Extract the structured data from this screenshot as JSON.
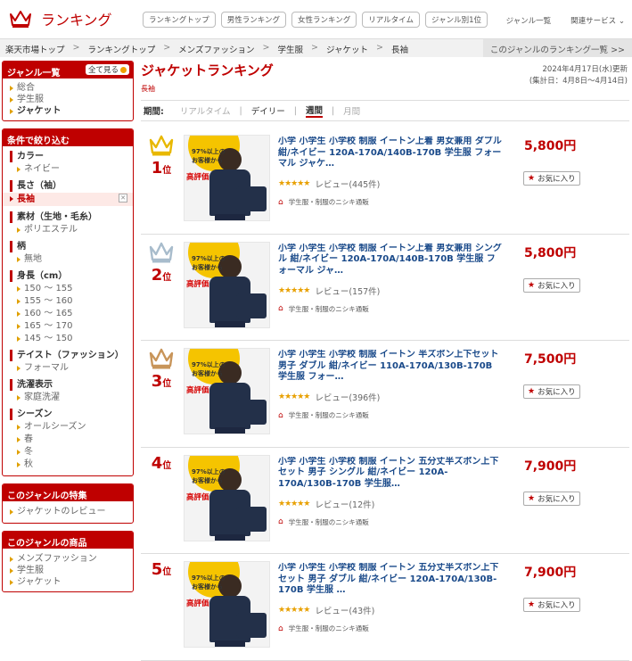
{
  "header": {
    "logo_text": "ランキング",
    "nav": [
      "ランキングトップ",
      "男性ランキング",
      "女性ランキング",
      "リアルタイム",
      "ジャンル別1位"
    ],
    "links": [
      "ジャンル一覧",
      "関連サービス"
    ]
  },
  "breadcrumb": {
    "items": [
      "楽天市場トップ",
      "ランキングトップ",
      "メンズファッション",
      "学生服",
      "ジャケット",
      "長袖"
    ],
    "right_link": "このジャンルのランキング一覧 >>"
  },
  "sidebar": {
    "genre": {
      "title": "ジャンル一覧",
      "all_button": "全て見る",
      "items": [
        "総合",
        "学生服",
        "ジャケット"
      ]
    },
    "filters": {
      "title": "条件で絞り込む",
      "groups": [
        {
          "name": "カラー",
          "options": [
            "ネイビー"
          ]
        },
        {
          "name": "長さ（袖）",
          "selected": "長袖"
        },
        {
          "name": "素材（生地・毛糸）",
          "options": [
            "ポリエステル"
          ]
        },
        {
          "name": "柄",
          "options": [
            "無地"
          ]
        },
        {
          "name": "身長（cm）",
          "options": [
            "150 ～ 155",
            "155 ～ 160",
            "160 ～ 165",
            "165 ～ 170",
            "145 ～ 150"
          ]
        },
        {
          "name": "テイスト（ファッション）",
          "options": [
            "フォーマル"
          ]
        },
        {
          "name": "洗濯表示",
          "options": [
            "家庭洗濯"
          ]
        },
        {
          "name": "シーズン",
          "options": [
            "オールシーズン",
            "春",
            "冬",
            "秋"
          ]
        }
      ]
    },
    "feature": {
      "title": "このジャンルの特集",
      "items": [
        "ジャケットのレビュー"
      ]
    },
    "products": {
      "title": "このジャンルの商品",
      "items": [
        "メンズファッション",
        "学生服",
        "ジャケット"
      ]
    }
  },
  "main": {
    "title": "ジャケットランキング",
    "subtitle": "長袖",
    "date_line1": "2024年4月17日(水)更新",
    "date_line2": "(集計日：4月8日～4月14日)",
    "period_label": "期間:",
    "periods": [
      "リアルタイム",
      "デイリー",
      "週間",
      "月間"
    ],
    "active_period": "週間"
  },
  "items": [
    {
      "rank": "1",
      "rank_suffix": "位",
      "crown": "#e8b800",
      "title": "小学 小学生 小学校 制服 イートン上着 男女兼用 ダブル 紺/ネイビー 120A-170A/140B-170B 学生服 フォーマル ジャケ…",
      "stars": "★★★★★",
      "reviews": "レビュー(445件)",
      "shop": "学生服・制服のニシキ通販",
      "price": "5,800円",
      "fav": "お気に入り",
      "badge_pct": "97%以上の",
      "badge_line2": "お客様から",
      "badge_big": "高評価"
    },
    {
      "rank": "2",
      "rank_suffix": "位",
      "crown": "#a8bccc",
      "title": "小学 小学生 小学校 制服 イートン上着 男女兼用 シングル 紺/ネイビー 120A-170A/140B-170B 学生服 フォーマル ジャ…",
      "stars": "★★★★★",
      "reviews": "レビュー(157件)",
      "shop": "学生服・制服のニシキ通販",
      "price": "5,800円",
      "fav": "お気に入り",
      "badge_pct": "97%以上の",
      "badge_line2": "お客様から",
      "badge_big": "高評価"
    },
    {
      "rank": "3",
      "rank_suffix": "位",
      "crown": "#c8955a",
      "title": "小学 小学生 小学校 制服 イートン 半ズボン上下セット 男子 ダブル 紺/ネイビー 110A-170A/130B-170B 学生服 フォー…",
      "stars": "★★★★★",
      "reviews": "レビュー(396件)",
      "shop": "学生服・制服のニシキ通販",
      "price": "7,500円",
      "fav": "お気に入り",
      "badge_pct": "97%以上の",
      "badge_line2": "お客様から",
      "badge_big": "高評価"
    },
    {
      "rank": "4",
      "rank_suffix": "位",
      "crown": "",
      "title": "小学 小学生 小学校 制服 イートン 五分丈半ズボン上下セット 男子 シングル 紺/ネイビー 120A-170A/130B-170B 学生服…",
      "stars": "★★★★★",
      "reviews": "レビュー(12件)",
      "shop": "学生服・制服のニシキ通販",
      "price": "7,900円",
      "fav": "お気に入り",
      "badge_pct": "97%以上の",
      "badge_line2": "お客様から",
      "badge_big": "高評価"
    },
    {
      "rank": "5",
      "rank_suffix": "位",
      "crown": "",
      "title": "小学 小学生 小学校 制服 イートン 五分丈半ズボン上下セット 男子 ダブル 紺/ネイビー 120A-170A/130B-170B 学生服 …",
      "stars": "★★★★★",
      "reviews": "レビュー(43件)",
      "shop": "学生服・制服のニシキ通販",
      "price": "7,900円",
      "fav": "お気に入り",
      "badge_pct": "97%以上の",
      "badge_line2": "お客様から",
      "badge_big": "高評価"
    }
  ]
}
